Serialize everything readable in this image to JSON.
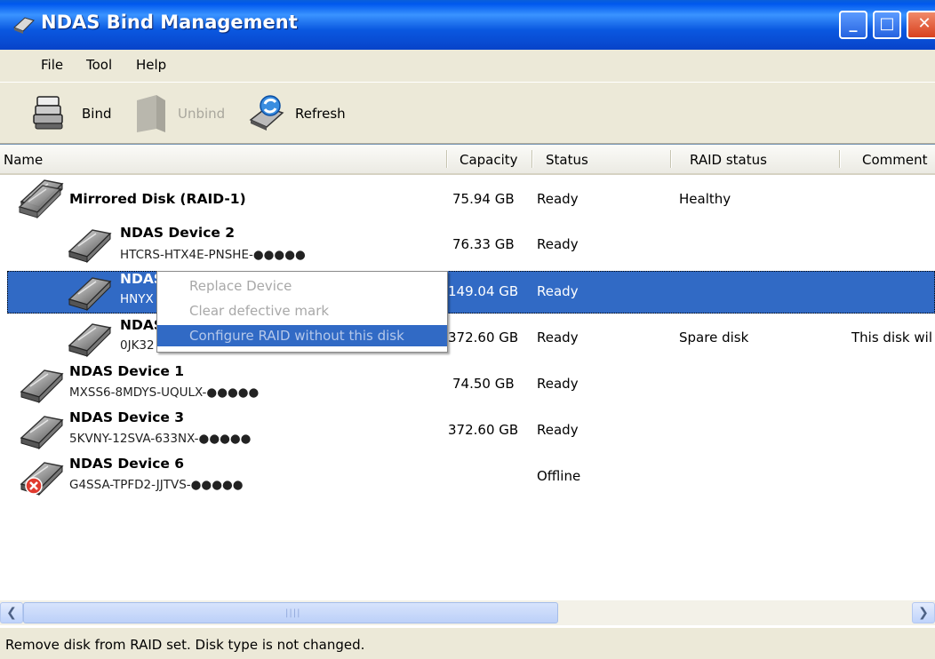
{
  "window": {
    "title": "NDAS Bind Management"
  },
  "menubar": {
    "items": [
      "File",
      "Tool",
      "Help"
    ]
  },
  "toolbar": {
    "bind": "Bind",
    "unbind": "Unbind",
    "refresh": "Refresh"
  },
  "columns": {
    "name": "Name",
    "capacity": "Capacity",
    "status": "Status",
    "raid_status": "RAID status",
    "comment": "Comment"
  },
  "rows": [
    {
      "name": "Mirrored Disk (RAID-1)",
      "id": "",
      "capacity": "75.94 GB",
      "status": "Ready",
      "raid_status": "Healthy",
      "comment": ""
    },
    {
      "name": "NDAS Device 2",
      "id": "HTCRS-HTX4E-PNSHE-●●●●●",
      "capacity": "76.33 GB",
      "status": "Ready",
      "raid_status": "",
      "comment": ""
    },
    {
      "name": "NDAS",
      "id": "HNYX",
      "capacity": "149.04 GB",
      "status": "Ready",
      "raid_status": "",
      "comment": ""
    },
    {
      "name": "NDAS",
      "id": "0JK32",
      "capacity": "372.60 GB",
      "status": "Ready",
      "raid_status": "Spare disk",
      "comment": "This disk wil"
    },
    {
      "name": "NDAS Device 1",
      "id": "MXSS6-8MDYS-UQULX-●●●●●",
      "capacity": "74.50 GB",
      "status": "Ready",
      "raid_status": "",
      "comment": ""
    },
    {
      "name": "NDAS Device 3",
      "id": "5KVNY-12SVA-633NX-●●●●●",
      "capacity": "372.60 GB",
      "status": "Ready",
      "raid_status": "",
      "comment": ""
    },
    {
      "name": "NDAS Device 6",
      "id": "G4SSA-TPFD2-JJTVS-●●●●●",
      "capacity": "",
      "status": "Offline",
      "raid_status": "",
      "comment": ""
    }
  ],
  "context_menu": {
    "items": [
      "Replace Device",
      "Clear defective mark",
      "Configure RAID without this disk"
    ],
    "highlighted": "Configure RAID without this disk"
  },
  "statusbar": {
    "text": "Remove disk from RAID set. Disk type is not changed."
  },
  "colors": {
    "selection": "#316ac5",
    "titlebar": "#0a58e0",
    "background": "#ece9d8"
  },
  "icons": [
    "ndas-title-icon",
    "bind-icon",
    "unbind-icon",
    "refresh-icon",
    "disk-icon",
    "offline-disk-icon"
  ]
}
